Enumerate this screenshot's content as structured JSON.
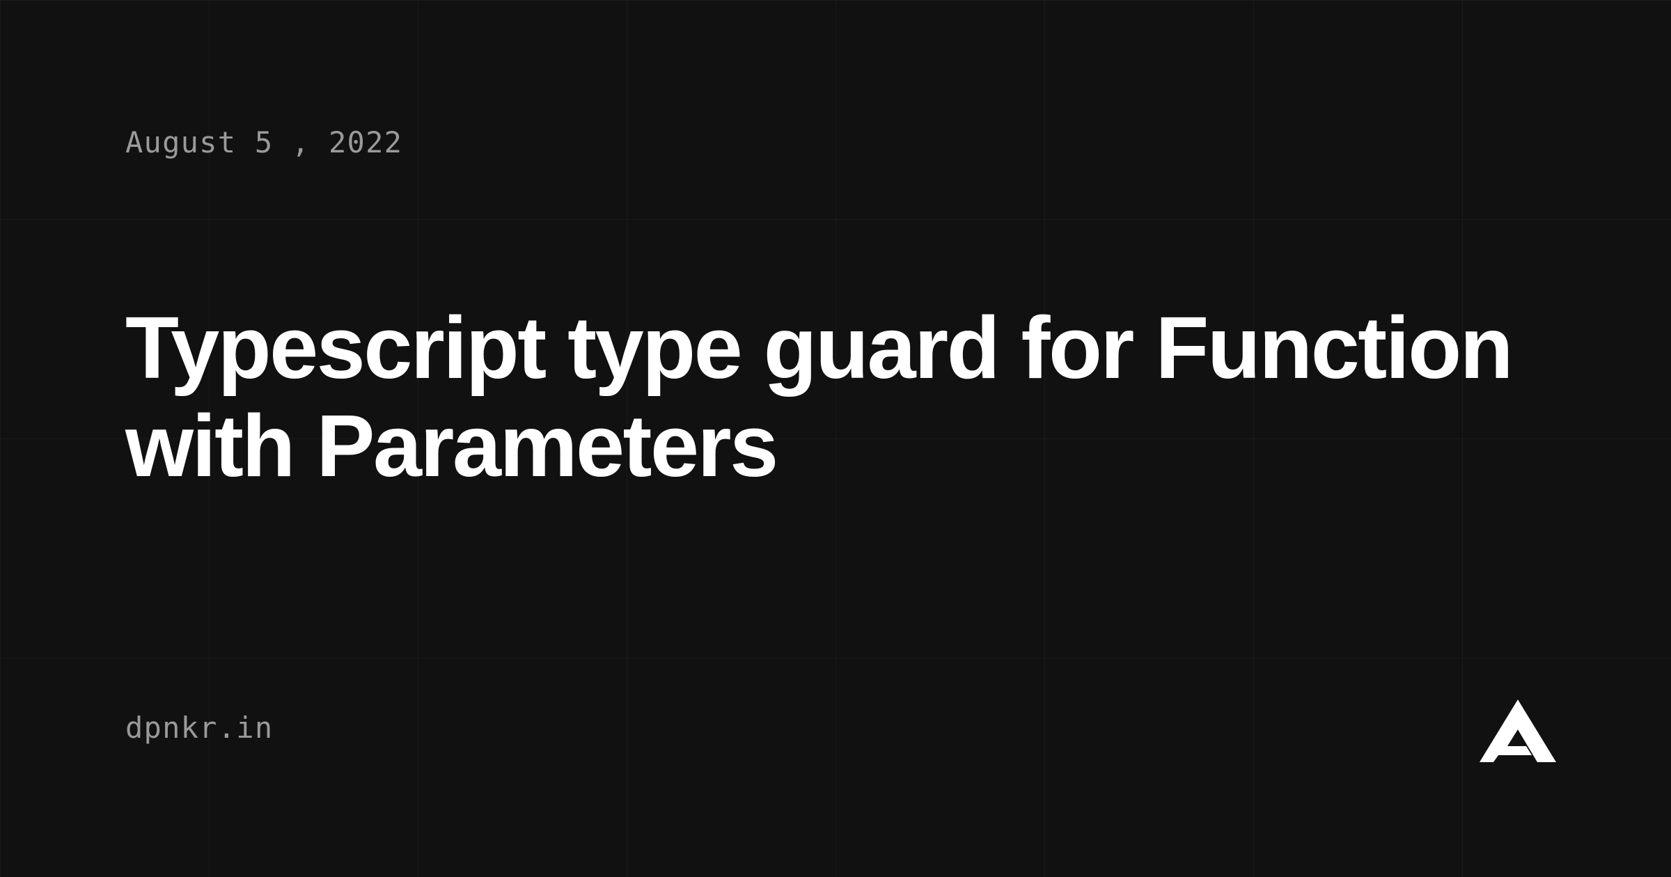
{
  "date": "August 5 , 2022",
  "title": "Typescript type guard for Function with Parameters",
  "domain": "dpnkr.in"
}
